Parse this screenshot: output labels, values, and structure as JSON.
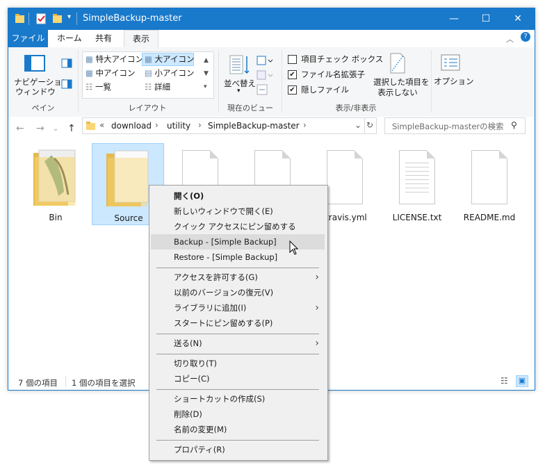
{
  "window": {
    "title": "SimpleBackup-master",
    "controls": {
      "minimize": "—",
      "maximize": "☐",
      "close": "✕"
    }
  },
  "ribbon_tabs": [
    "ファイル",
    "ホーム",
    "共有",
    "表示"
  ],
  "ribbon": {
    "pane": {
      "nav_label_1": "ナビゲーション",
      "nav_label_2": "ウィンドウ",
      "group": "ペイン"
    },
    "layout": {
      "options": [
        "特大アイコン",
        "大アイコン",
        "中アイコン",
        "小アイコン",
        "一覧",
        "詳細"
      ],
      "selected": "大アイコン",
      "group": "レイアウト"
    },
    "view": {
      "sort_label": "並べ替え",
      "group": "現在のビュー"
    },
    "showhide": {
      "item_checkboxes": "項目チェック ボックス",
      "file_extensions": "ファイル名拡張子",
      "hidden_items": "隠しファイル",
      "hide_selected_1": "選択した項目を",
      "hide_selected_2": "表示しない",
      "group": "表示/非表示"
    },
    "options": "オプション"
  },
  "address": {
    "path": [
      "download",
      "utility",
      "SimpleBackup-master"
    ],
    "search_placeholder": "SimpleBackup-masterの検索"
  },
  "items": [
    {
      "name": "Bin",
      "type": "folder"
    },
    {
      "name": "Source",
      "type": "folder"
    },
    {
      "name": "",
      "type": "file"
    },
    {
      "name": "",
      "type": "file"
    },
    {
      "name": ".travis.yml",
      "type": "file"
    },
    {
      "name": "LICENSE.txt",
      "type": "text"
    },
    {
      "name": "README.md",
      "type": "file"
    }
  ],
  "status": {
    "count": "7 個の項目",
    "selected": "1 個の項目を選択"
  },
  "context_menu": {
    "open": "開く(O)",
    "new_window": "新しいウィンドウで開く(E)",
    "pin_quick": "クイック アクセスにピン留めする",
    "backup": "Backup - [Simple Backup]",
    "restore": "Restore - [Simple Backup]",
    "give_access": "アクセスを許可する(G)",
    "restore_prev": "以前のバージョンの復元(V)",
    "add_library": "ライブラリに追加(I)",
    "pin_start": "スタートにピン留めする(P)",
    "send_to": "送る(N)",
    "cut": "切り取り(T)",
    "copy": "コピー(C)",
    "shortcut": "ショートカットの作成(S)",
    "delete": "削除(D)",
    "rename": "名前の変更(M)",
    "properties": "プロパティ(R)"
  }
}
